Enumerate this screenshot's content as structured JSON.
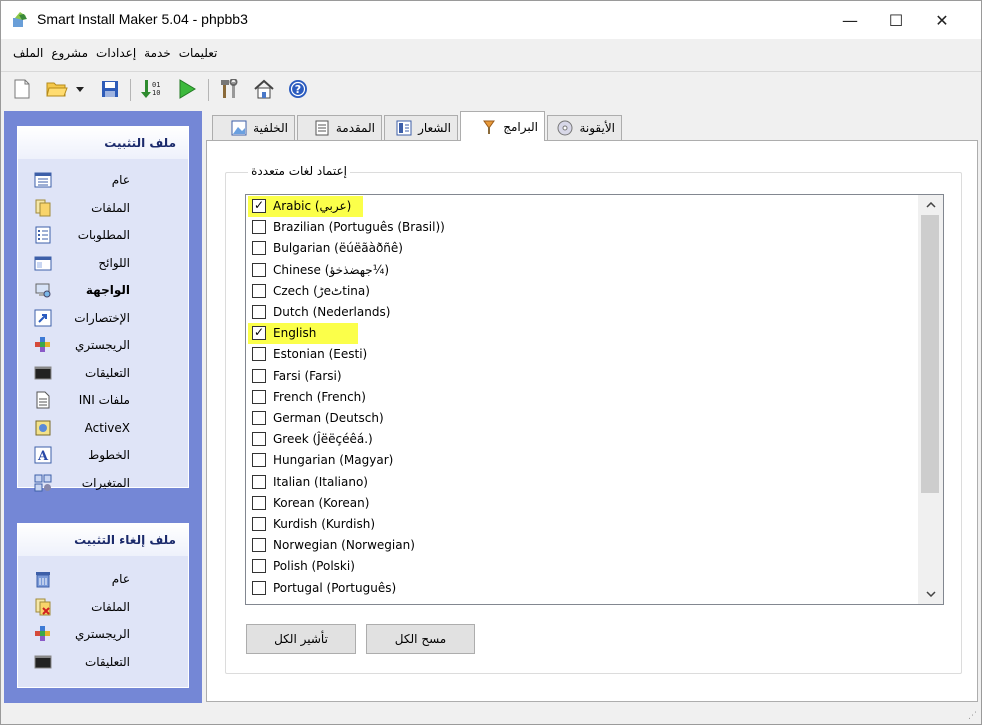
{
  "window": {
    "title": "Smart Install Maker 5.04 - phpbb3",
    "minimize": "—",
    "maximize": "☐",
    "close": "✕"
  },
  "menu": [
    "الملف",
    "مشروع",
    "إعدادات",
    "خدمة",
    "تعليمات"
  ],
  "toolbar_icons": [
    "new-file-icon",
    "open-folder-icon",
    "dropdown-arrow-icon",
    "save-icon",
    "compile-icon",
    "run-icon",
    "tools-icon",
    "home-icon",
    "help-icon"
  ],
  "sidebar": {
    "install": {
      "title": "ملف التثبيت",
      "items": [
        {
          "label": "عام",
          "icon": "general-icon"
        },
        {
          "label": "الملفات",
          "icon": "files-icon"
        },
        {
          "label": "المطلوبات",
          "icon": "requirements-icon"
        },
        {
          "label": "اللوائح",
          "icon": "dialogs-icon"
        },
        {
          "label": "الواجهة",
          "icon": "interface-icon",
          "selected": true
        },
        {
          "label": "الإختصارات",
          "icon": "shortcuts-icon"
        },
        {
          "label": "الريجستري",
          "icon": "registry-icon"
        },
        {
          "label": "التعليقات",
          "icon": "commands-icon"
        },
        {
          "label": "ملفات INI",
          "icon": "ini-files-icon"
        },
        {
          "label": "ActiveX",
          "icon": "activex-icon"
        },
        {
          "label": "الخطوط",
          "icon": "fonts-icon"
        },
        {
          "label": "المتغيرات",
          "icon": "variables-icon"
        }
      ]
    },
    "uninstall": {
      "title": "ملف إلغاء التثبيت",
      "items": [
        {
          "label": "عام",
          "icon": "uninstall-general-icon"
        },
        {
          "label": "الملفات",
          "icon": "uninstall-files-icon"
        },
        {
          "label": "الريجستري",
          "icon": "uninstall-registry-icon"
        },
        {
          "label": "التعليقات",
          "icon": "uninstall-commands-icon"
        }
      ]
    }
  },
  "tabs": [
    {
      "label": "الخلفية",
      "icon": "background-icon"
    },
    {
      "label": "المقدمة",
      "icon": "intro-icon"
    },
    {
      "label": "الشعار",
      "icon": "logo-icon"
    },
    {
      "label": "البرامج",
      "icon": "programs-icon",
      "active": true
    },
    {
      "label": "الأيقونة",
      "icon": "cd-icon"
    }
  ],
  "group_label": "إعتماد لغات متعددة",
  "languages": [
    {
      "label": "Arabic (عربي)",
      "checked": true,
      "highlight": true
    },
    {
      "label": "Brazilian (Português (Brasil))",
      "checked": false
    },
    {
      "label": "Bulgarian (ëúëãàðñê)",
      "checked": false
    },
    {
      "label": "Chinese (جهضذخؤ¼)",
      "checked": false
    },
    {
      "label": "Czech (ڑeٹtina)",
      "checked": false
    },
    {
      "label": "Dutch (Nederlands)",
      "checked": false
    },
    {
      "label": "English",
      "checked": true,
      "highlight": true
    },
    {
      "label": "Estonian (Eesti)",
      "checked": false
    },
    {
      "label": "Farsi (Farsi)",
      "checked": false
    },
    {
      "label": "French (French)",
      "checked": false
    },
    {
      "label": "German (Deutsch)",
      "checked": false
    },
    {
      "label": "Greek (Ĵëëçéêá.)",
      "checked": false
    },
    {
      "label": "Hungarian (Magyar)",
      "checked": false
    },
    {
      "label": "Italian (Italiano)",
      "checked": false
    },
    {
      "label": "Korean (Korean)",
      "checked": false
    },
    {
      "label": "Kurdish (Kurdish)",
      "checked": false
    },
    {
      "label": "Norwegian (Norwegian)",
      "checked": false
    },
    {
      "label": "Polish (Polski)",
      "checked": false
    },
    {
      "label": "Portugal (Português)",
      "checked": false
    }
  ],
  "buttons": {
    "select_all": "تأشير الكل",
    "clear_all": "مسح الكل"
  },
  "colors": {
    "sidebar_bg": "#7487d6",
    "highlight": "#fbff4a"
  }
}
